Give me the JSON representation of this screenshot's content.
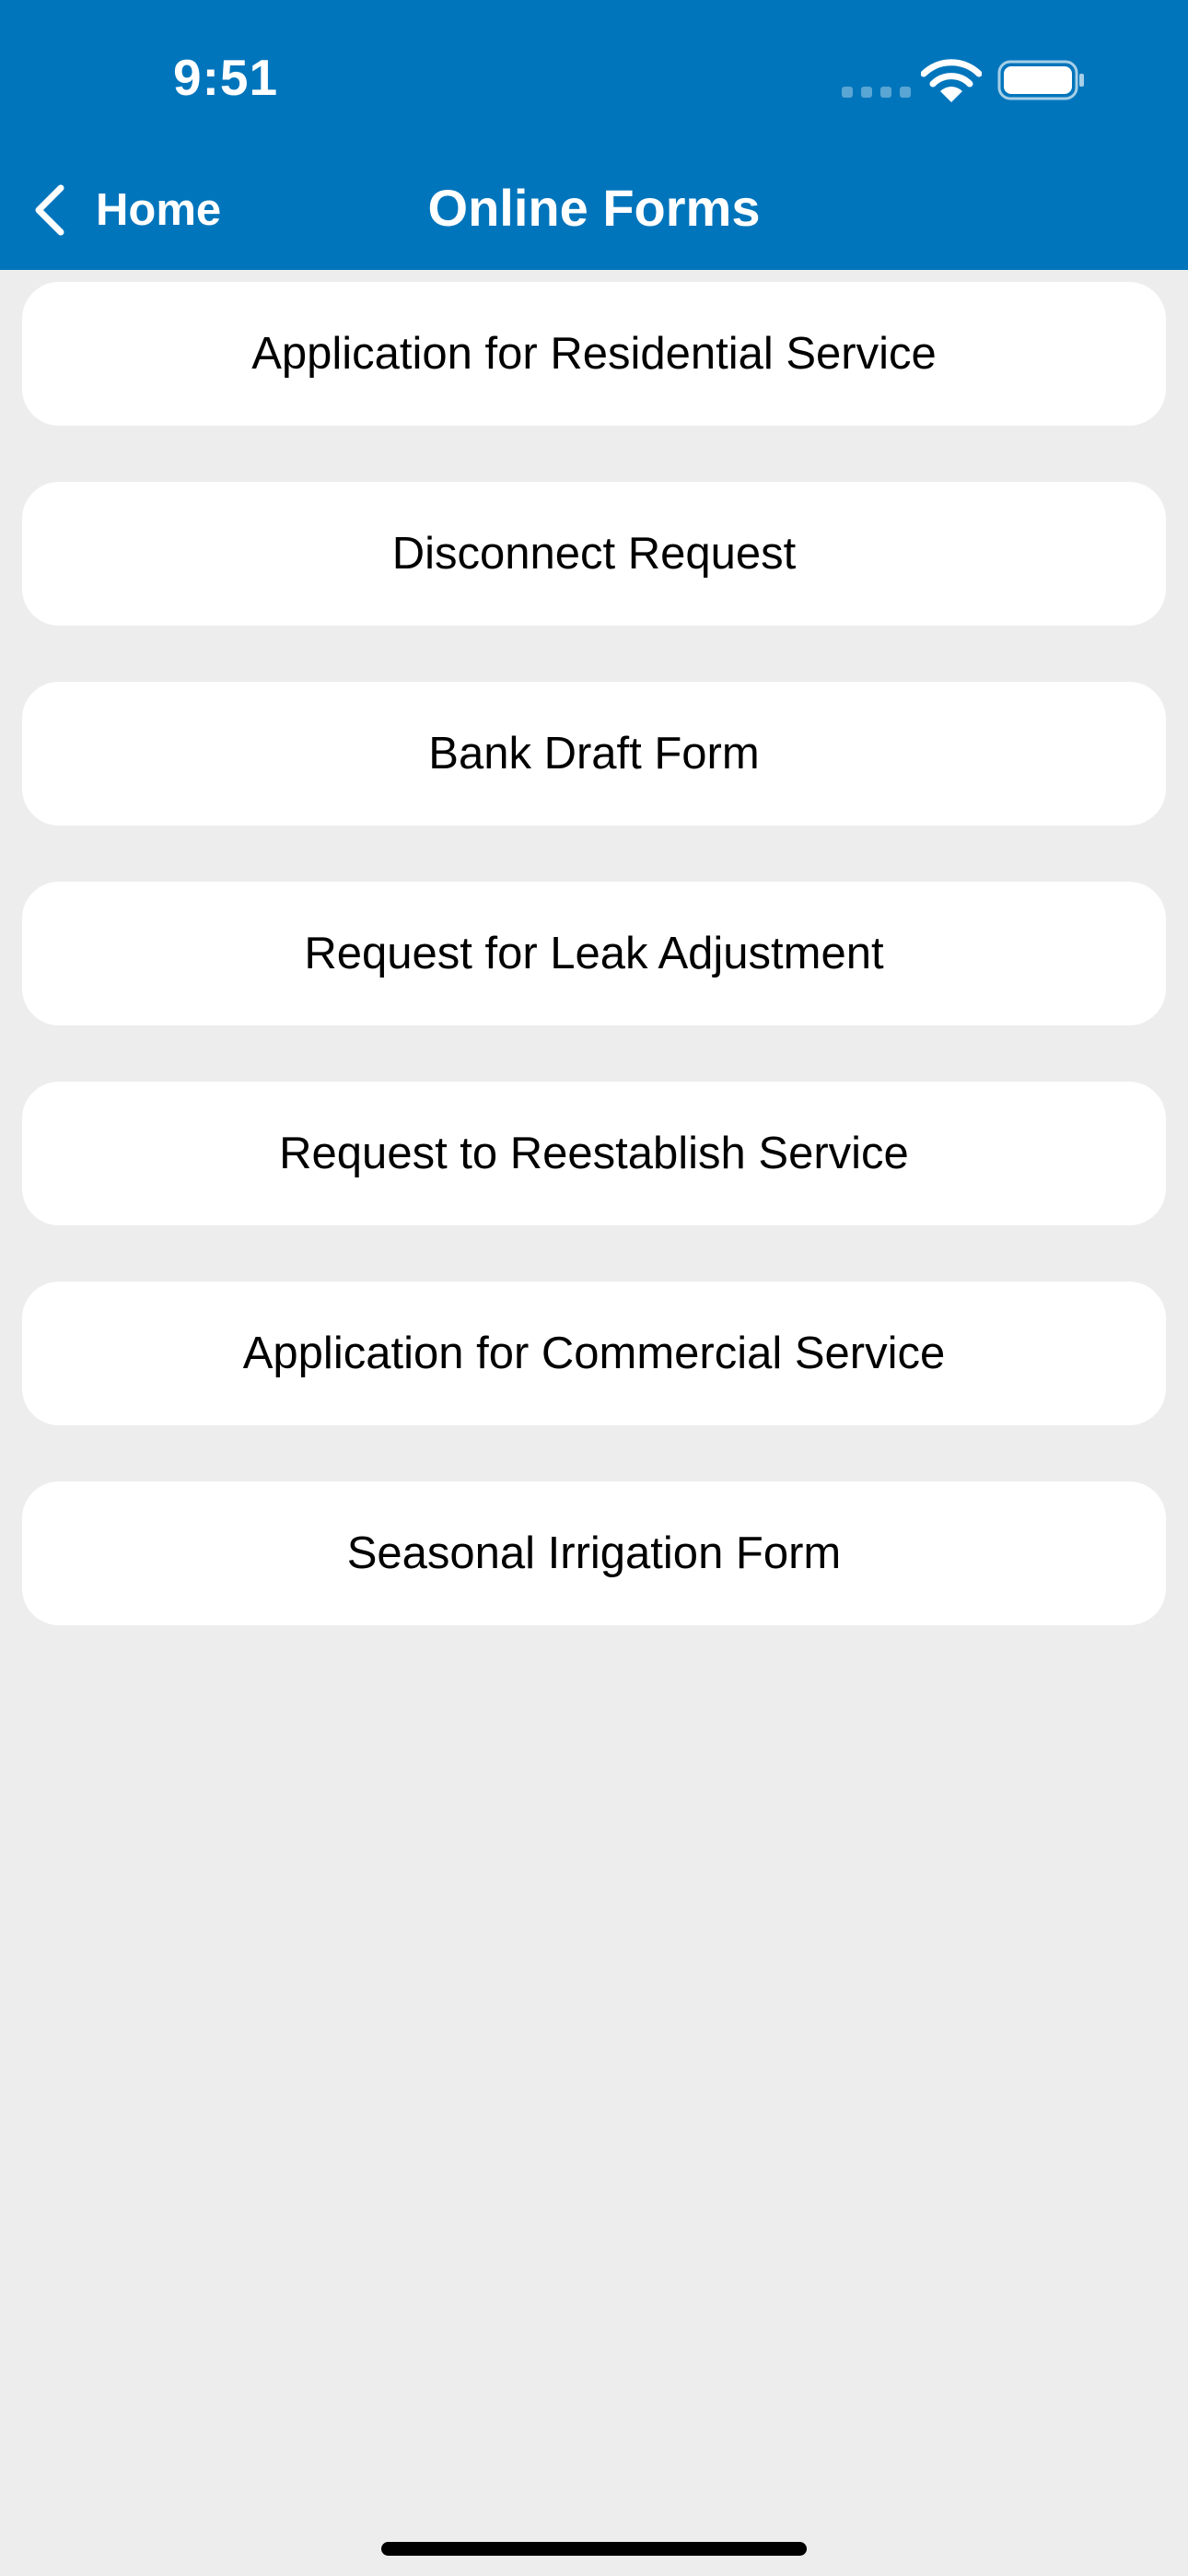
{
  "status_bar": {
    "time": "9:51"
  },
  "nav": {
    "back_label": "Home",
    "title": "Online Forms"
  },
  "forms": [
    {
      "label": "Application for Residential Service"
    },
    {
      "label": "Disconnect Request"
    },
    {
      "label": "Bank Draft Form"
    },
    {
      "label": "Request for Leak Adjustment"
    },
    {
      "label": "Request to Reestablish Service"
    },
    {
      "label": "Application for Commercial Service"
    },
    {
      "label": "Seasonal Irrigation Form"
    }
  ],
  "icons": {
    "back": "chevron-left-icon",
    "signal": "cellular-signal-icon",
    "wifi": "wifi-icon",
    "battery": "battery-icon"
  },
  "colors": {
    "header_background": "#0175bc",
    "page_background": "#ededed",
    "item_background": "#ffffff"
  }
}
